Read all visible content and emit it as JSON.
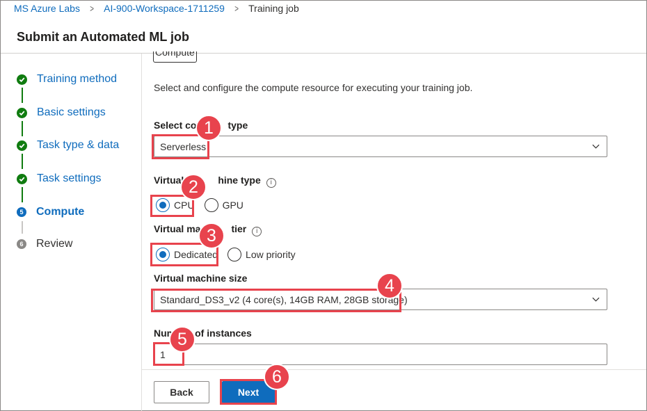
{
  "breadcrumb": {
    "items": [
      "MS Azure Labs",
      "AI-900-Workspace-1711259"
    ],
    "current": "Training job",
    "separator": ">"
  },
  "page_title": "Submit an Automated ML job",
  "steps": [
    {
      "label": "Training method",
      "state": "complete"
    },
    {
      "label": "Basic settings",
      "state": "complete"
    },
    {
      "label": "Task type & data",
      "state": "complete"
    },
    {
      "label": "Task settings",
      "state": "complete"
    },
    {
      "label": "Compute",
      "state": "active",
      "number": "5"
    },
    {
      "label": "Review",
      "state": "pending",
      "number": "6"
    }
  ],
  "section": {
    "title": "Compute",
    "description": "Select and configure the compute resource for executing your training job."
  },
  "compute_type": {
    "label_part1": "Select co",
    "label_part2": "type",
    "value": "Serverless"
  },
  "vm_type": {
    "label_part1": "Virtual",
    "label_part2": "hine type",
    "options": [
      "CPU",
      "GPU"
    ],
    "selected": "CPU"
  },
  "vm_tier": {
    "label_part1": "Virtual ma",
    "label_part2": "tier",
    "options": [
      "Dedicated",
      "Low priority"
    ],
    "selected": "Dedicated"
  },
  "vm_size": {
    "label": "Virtual machine size",
    "value": "Standard_DS3_v2 (4 core(s), 14GB RAM, 28GB storage)"
  },
  "instances": {
    "label_part1": "Num",
    "label_part2": "of instances",
    "value": "1"
  },
  "callouts": [
    "1",
    "2",
    "3",
    "4",
    "5",
    "6"
  ],
  "buttons": {
    "back": "Back",
    "next": "Next"
  },
  "info_glyph": "i",
  "colors": {
    "accent": "#0f6cbd",
    "success": "#107c10",
    "highlight": "#e8434d"
  }
}
